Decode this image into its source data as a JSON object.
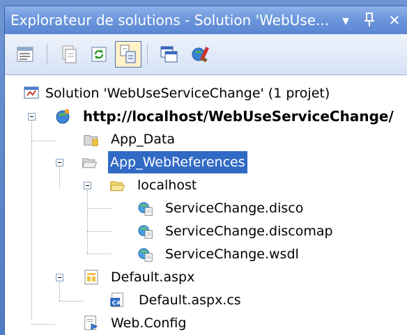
{
  "window": {
    "title": "Explorateur de solutions - Solution 'WebUse...",
    "dropdown_glyph": "▾",
    "pin_glyph": "⊥",
    "close_glyph": "✕"
  },
  "toolbar": {
    "buttons": [
      {
        "name": "properties-icon"
      },
      {
        "name": "show-all-files-icon"
      },
      {
        "name": "refresh-icon"
      },
      {
        "name": "nest-related-files-icon",
        "pressed": true
      },
      {
        "name": "view-designer-icon"
      },
      {
        "name": "web-site-configuration-icon"
      }
    ]
  },
  "tree": {
    "solution": "Solution 'WebUseServiceChange' (1 projet)",
    "project": "http://localhost/WebUseServiceChange/",
    "app_data": "App_Data",
    "app_webreferences": "App_WebReferences",
    "localhost": "localhost",
    "disco": "ServiceChange.disco",
    "discomap": "ServiceChange.discomap",
    "wsdl": "ServiceChange.wsdl",
    "default_aspx": "Default.aspx",
    "default_aspx_cs": "Default.aspx.cs",
    "web_config": "Web.Config"
  },
  "colors": {
    "selection": "#316ac5",
    "titlebar": "#6d97dc",
    "folder": "#f3d66b"
  }
}
